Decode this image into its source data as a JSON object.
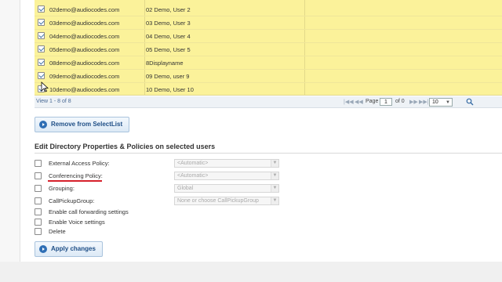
{
  "user_rows": [
    {
      "email": "02demo@audiocodes.com",
      "display_name": "02 Demo, User 2"
    },
    {
      "email": "03demo@audiocodes.com",
      "display_name": "03 Demo, User 3"
    },
    {
      "email": "04demo@audiocodes.com",
      "display_name": "04 Demo, User 4"
    },
    {
      "email": "05demo@audiocodes.com",
      "display_name": "05 Demo, User 5"
    },
    {
      "email": "08demo@audiocodes.com",
      "display_name": "8Displayname"
    },
    {
      "email": "09demo@audiocodes.com",
      "display_name": "09 Demo, user 9"
    },
    {
      "email": "10demo@audiocodes.com",
      "display_name": "10 Demo, User 10"
    }
  ],
  "pager": {
    "view_info": "View 1 - 8 of 8",
    "page_label": "Page",
    "page_value": "1",
    "of_label": "of 0",
    "rows_per_page": "10",
    "first_glyph": "|◀◀",
    "prev_glyph": "◀◀",
    "next_glyph": "▶▶",
    "last_glyph": "▶▶|"
  },
  "remove_button_label": "Remove from SelectList",
  "section_title": "Edit Directory Properties & Policies on selected users",
  "properties": [
    {
      "label": "External Access Policy:",
      "select": "<Automatic>"
    },
    {
      "label": "Conferencing Policy:",
      "select": "<Automatic>"
    },
    {
      "label": "Grouping:",
      "select": "Global"
    },
    {
      "label": "CallPickupGroup:",
      "select": "None or choose CallPickupGroup"
    },
    {
      "label": "Enable call forwarding settings"
    },
    {
      "label": "Enable Voice settings"
    },
    {
      "label": "Delete"
    }
  ],
  "apply_button_label": "Apply changes",
  "colors": {
    "grid_row_highlight": "#fbf29a",
    "button_text": "#1e4e86",
    "annotation_underline": "#d6202b"
  },
  "icons": {
    "checkbox": "checkmark",
    "button": "circle-arrow-icon",
    "search": "magnifier-icon",
    "cursor": "mouse-pointer"
  }
}
